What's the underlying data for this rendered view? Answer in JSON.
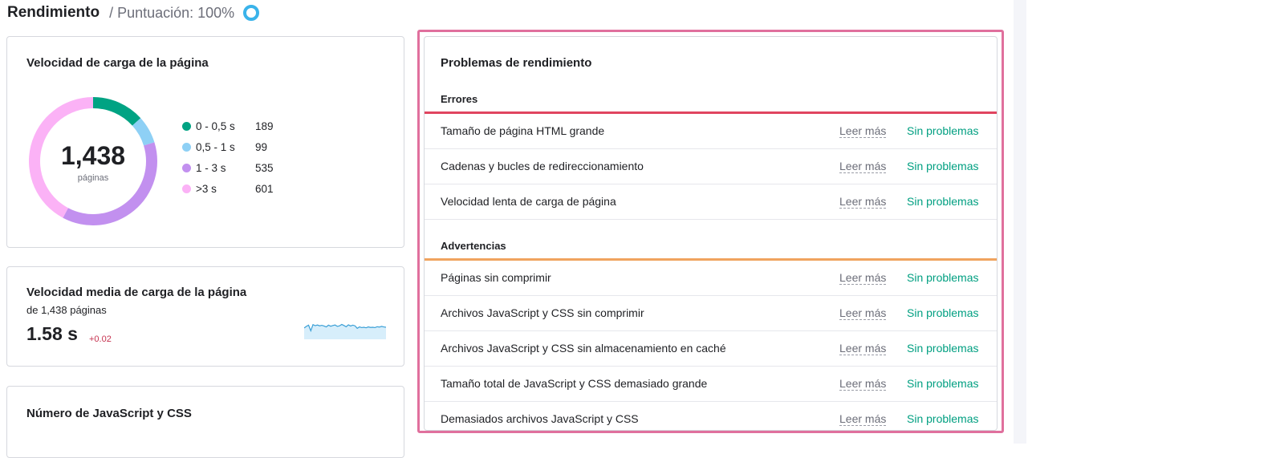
{
  "header": {
    "title": "Rendimiento",
    "score": "/ Puntuación: 100%",
    "score_icon": "score-ring-icon",
    "score_color": "#3ab3ea"
  },
  "load_speed_card": {
    "title": "Velocidad de carga de la página",
    "total": "1,438",
    "total_label": "páginas",
    "segments": [
      {
        "label": "0 - 0,5 s",
        "count": "189",
        "value": 189,
        "color": "#00a383"
      },
      {
        "label": "0,5 - 1 s",
        "count": "99",
        "value": 99,
        "color": "#8ed0f5"
      },
      {
        "label": "1 - 3 s",
        "count": "535",
        "value": 535,
        "color": "#c290ef"
      },
      {
        "label": ">3 s",
        "count": "601",
        "value": 601,
        "color": "#fbb2f6"
      }
    ]
  },
  "avg_speed_card": {
    "title": "Velocidad media de carga de la página",
    "subtitle": "de 1,438 páginas",
    "value": "1.58 s",
    "delta": "+0.02",
    "trend": [
      0.46,
      0.55,
      0.62,
      0.3,
      0.65,
      0.59,
      0.63,
      0.58,
      0.61,
      0.57,
      0.52,
      0.62,
      0.56,
      0.6,
      0.63,
      0.55,
      0.58,
      0.66,
      0.6,
      0.53,
      0.64,
      0.57,
      0.62,
      0.58,
      0.44,
      0.52,
      0.48,
      0.5,
      0.47,
      0.52,
      0.49,
      0.5,
      0.48,
      0.53,
      0.51,
      0.55,
      0.52,
      0.5
    ],
    "line_color": "#3a9fd6",
    "fill_color": "#d7eefb"
  },
  "js_css_card": {
    "title": "Número de JavaScript y CSS"
  },
  "issues_card": {
    "title": "Problemas de rendimiento",
    "read_more": "Leer más",
    "status_ok": "Sin problemas",
    "errors": {
      "heading": "Errores",
      "color": "#e0455f",
      "items": [
        {
          "name": "Tamaño de página HTML grande"
        },
        {
          "name": "Cadenas y bucles de redireccionamiento"
        },
        {
          "name": "Velocidad lenta de carga de página"
        }
      ]
    },
    "warnings": {
      "heading": "Advertencias",
      "color": "#f0a35e",
      "items": [
        {
          "name": "Páginas sin comprimir"
        },
        {
          "name": "Archivos JavaScript y CSS sin comprimir"
        },
        {
          "name": "Archivos JavaScript y CSS sin almacenamiento en caché"
        },
        {
          "name": "Tamaño total de JavaScript y CSS demasiado grande"
        },
        {
          "name": "Demasiados archivos JavaScript y CSS"
        }
      ]
    }
  }
}
